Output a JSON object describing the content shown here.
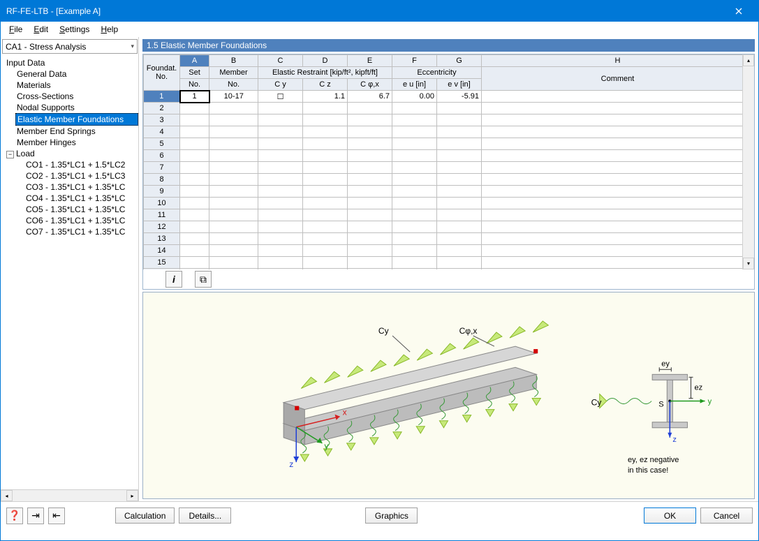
{
  "window": {
    "title": "RF-FE-LTB - [Example A]"
  },
  "menu": {
    "file": "File",
    "edit": "Edit",
    "settings": "Settings",
    "help": "Help"
  },
  "combo": {
    "selected": "CA1 - Stress Analysis"
  },
  "tree": {
    "root": "Input Data",
    "items": [
      "General Data",
      "Materials",
      "Cross-Sections",
      "Nodal Supports",
      "Elastic Member Foundations",
      "Member End Springs",
      "Member Hinges"
    ],
    "load": "Load",
    "loads": [
      "CO1 - 1.35*LC1 + 1.5*LC2",
      "CO2 - 1.35*LC1 + 1.5*LC3",
      "CO3 - 1.35*LC1 + 1.35*LC",
      "CO4 - 1.35*LC1 + 1.35*LC",
      "CO5 - 1.35*LC1 + 1.35*LC",
      "CO6 - 1.35*LC1 + 1.35*LC",
      "CO7 - 1.35*LC1 + 1.35*LC"
    ]
  },
  "panel": {
    "title": "1.5 Elastic Member Foundations"
  },
  "grid": {
    "letters": [
      "A",
      "B",
      "C",
      "D",
      "E",
      "F",
      "G",
      "H"
    ],
    "group1": "Foundat.\nNo.",
    "group2": {
      "set": "Set",
      "member": "Member",
      "restraint": "Elastic Restraint  [kip/ft², kipft/ft]",
      "ecc": "Eccentricity"
    },
    "sub": {
      "setno": "No.",
      "memberno": "No.",
      "cy": "C y",
      "cz": "C z",
      "cphix": "C φ,x",
      "eu": "e u [in]",
      "ev": "e v [in]",
      "comment": "Comment"
    },
    "rows": 18,
    "data": [
      {
        "set": "1",
        "member": "10-17",
        "cy": "☐",
        "cz": "1.1",
        "cphix": "6.7",
        "eu": "0.00",
        "ev": "-5.91",
        "comment": ""
      }
    ]
  },
  "diagram": {
    "cy_label": "Cy",
    "cphix_label": "Cφ,x",
    "x": "x",
    "y": "y",
    "z": "z",
    "ey": "ey",
    "ez": "ez",
    "s": "S",
    "note_line1": "ey, ez negative",
    "note_line2": "in this case!"
  },
  "buttons": {
    "calc": "Calculation",
    "details": "Details...",
    "graphics": "Graphics",
    "ok": "OK",
    "cancel": "Cancel"
  }
}
